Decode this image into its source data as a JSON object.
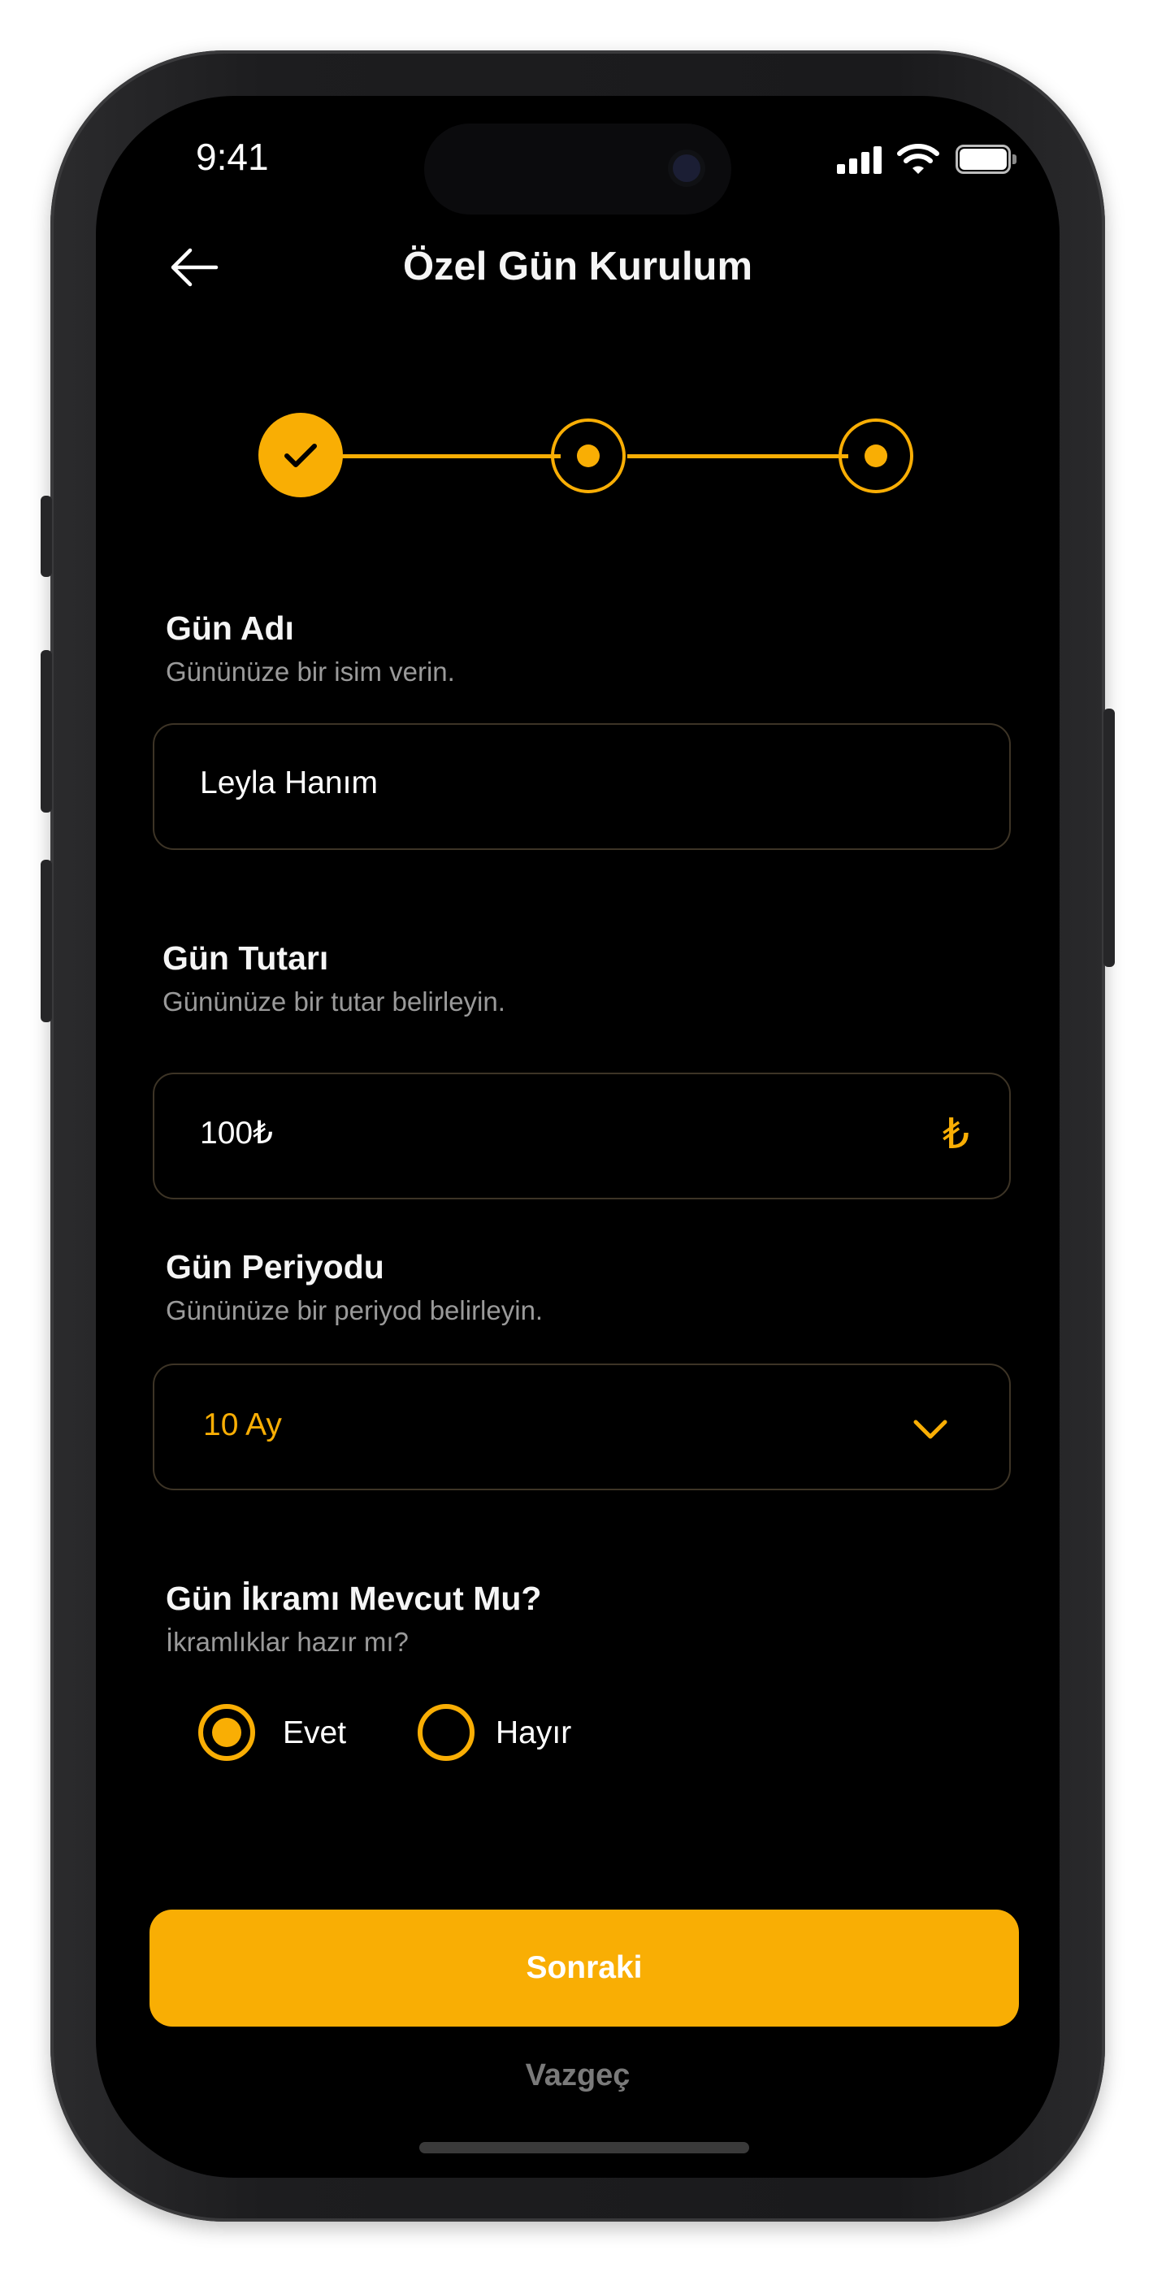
{
  "status_bar": {
    "time": "9:41"
  },
  "header": {
    "title": "Özel Gün Kurulum"
  },
  "form": {
    "name": {
      "label": "Gün Adı",
      "description": "Gününüze bir isim verin.",
      "value": "Leyla Hanım"
    },
    "amount": {
      "label": "Gün Tutarı",
      "description": "Gününüze bir tutar belirleyin.",
      "value": "100₺",
      "currency_symbol": "₺"
    },
    "period": {
      "label": "Gün Periyodu",
      "description": "Gününüze bir periyod belirleyin.",
      "selected": "10 Ay"
    },
    "treat": {
      "label": "Gün İkramı Mevcut Mu?",
      "description": "İkramlıklar hazır mı?",
      "options": [
        "Evet",
        "Hayır"
      ],
      "selected": "Evet"
    }
  },
  "actions": {
    "next_label": "Sonraki",
    "cancel_label": "Vazgeç"
  },
  "colors": {
    "accent": "#F9AE04",
    "background": "#000000",
    "field_border": "#3d3426"
  }
}
